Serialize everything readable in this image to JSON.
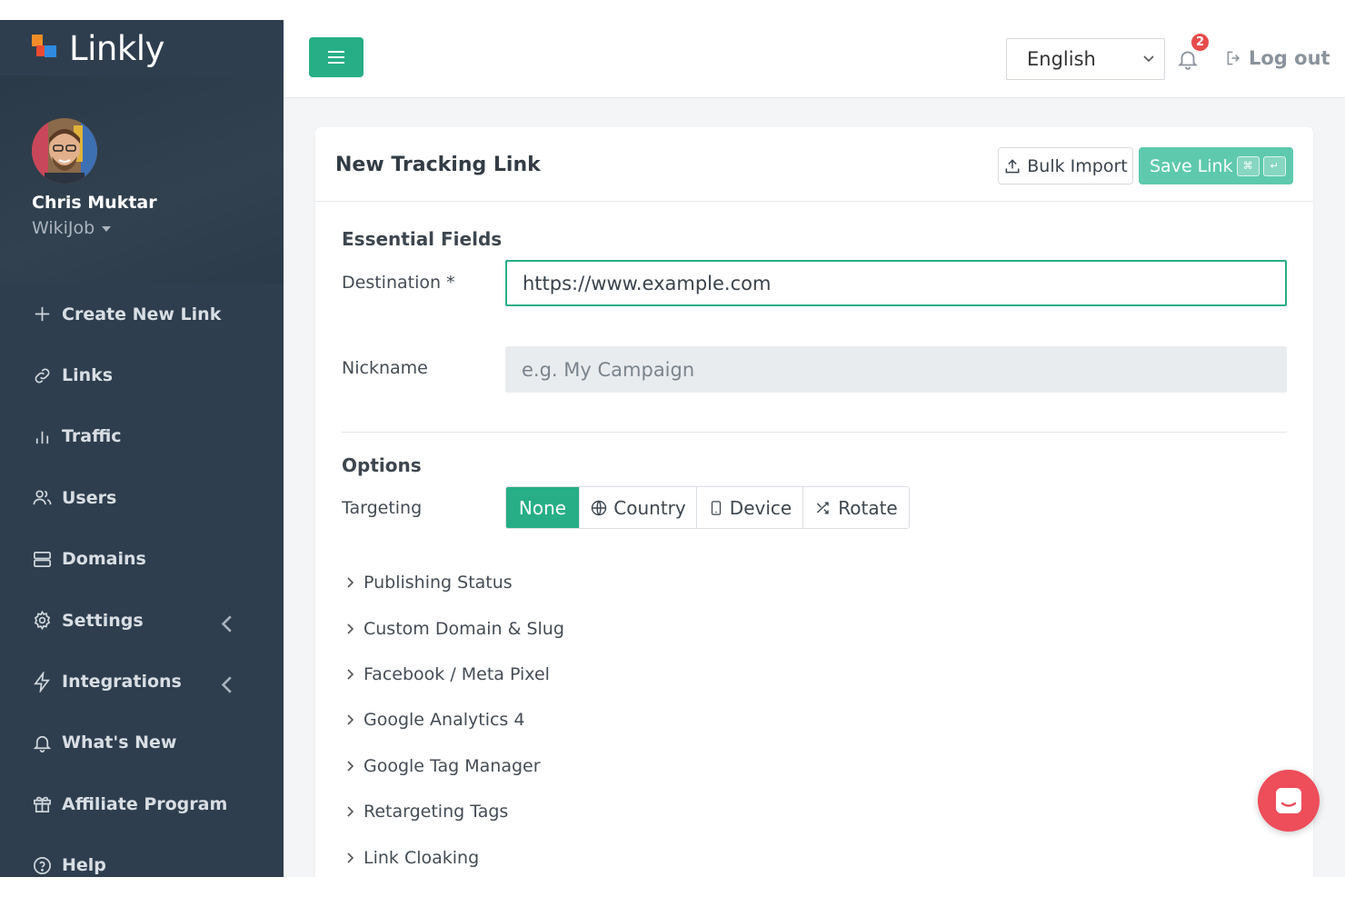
{
  "brand": {
    "name": "Linkly"
  },
  "profile": {
    "name": "Chris Muktar",
    "org": "WikiJob"
  },
  "nav": [
    {
      "label": "Create New Link",
      "icon": "plus-icon"
    },
    {
      "label": "Links",
      "icon": "link-icon"
    },
    {
      "label": "Traffic",
      "icon": "bar-chart-icon"
    },
    {
      "label": "Users",
      "icon": "users-icon"
    },
    {
      "label": "Domains",
      "icon": "server-icon"
    },
    {
      "label": "Settings",
      "icon": "gear-icon",
      "expandable": true
    },
    {
      "label": "Integrations",
      "icon": "lightning-icon",
      "expandable": true
    },
    {
      "label": "What's New",
      "icon": "bell-icon"
    },
    {
      "label": "Affiliate Program",
      "icon": "gift-icon"
    },
    {
      "label": "Help",
      "icon": "help-icon"
    }
  ],
  "topbar": {
    "language": "English",
    "notification_count": "2",
    "logout_label": "Log out"
  },
  "card": {
    "title": "New Tracking Link",
    "bulk_import_label": "Bulk Import",
    "save_label": "Save Link",
    "save_shortcut": [
      "⌘",
      "↵"
    ]
  },
  "form": {
    "essential_title": "Essential Fields",
    "destination_label": "Destination *",
    "destination_value": "https://www.example.com",
    "nickname_label": "Nickname",
    "nickname_placeholder": "e.g. My Campaign",
    "options_title": "Options",
    "targeting_label": "Targeting",
    "targeting_options": [
      {
        "label": "None",
        "active": true
      },
      {
        "label": "Country",
        "icon": "globe-icon"
      },
      {
        "label": "Device",
        "icon": "phone-icon"
      },
      {
        "label": "Rotate",
        "icon": "shuffle-icon"
      }
    ],
    "sections": [
      "Publishing Status",
      "Custom Domain & Slug",
      "Facebook / Meta Pixel",
      "Google Analytics 4",
      "Google Tag Manager",
      "Retargeting Tags",
      "Link Cloaking"
    ]
  },
  "colors": {
    "sidebar": "#2e3e4e",
    "accent": "#27ae86",
    "save_button": "#5ec9ad",
    "badge": "#e74c4c",
    "chat": "#ee4d5a"
  }
}
